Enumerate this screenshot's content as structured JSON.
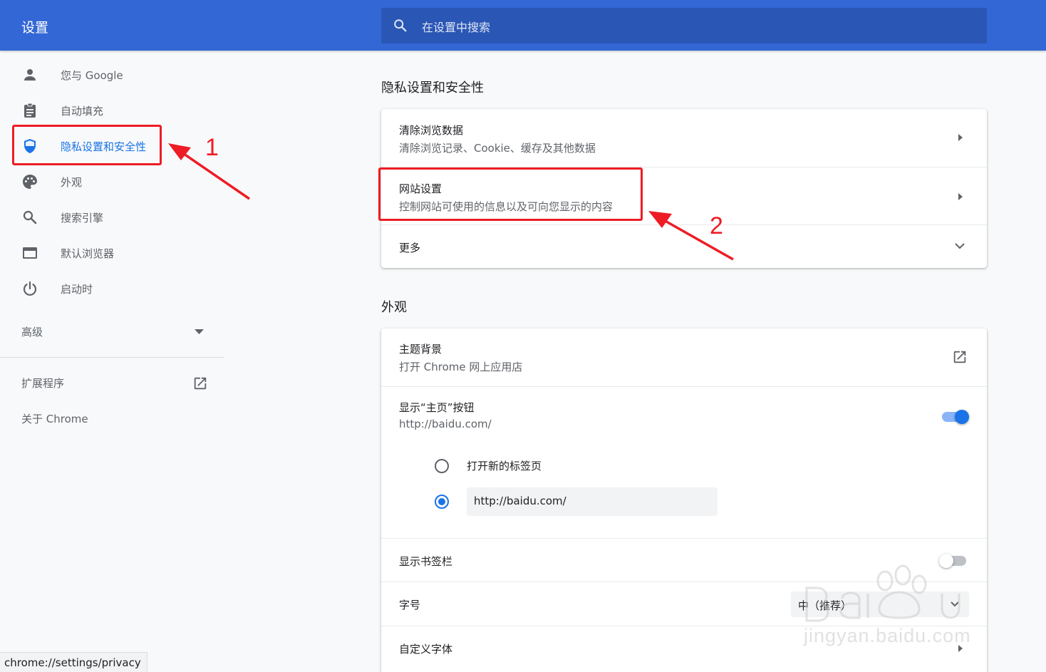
{
  "header": {
    "title": "设置",
    "search_placeholder": "在设置中搜索"
  },
  "sidebar": {
    "items": [
      {
        "label": "您与 Google",
        "icon": "person-icon"
      },
      {
        "label": "自动填充",
        "icon": "clipboard-icon"
      },
      {
        "label": "隐私设置和安全性",
        "icon": "shield-icon",
        "active": true
      },
      {
        "label": "外观",
        "icon": "palette-icon"
      },
      {
        "label": "搜索引擎",
        "icon": "search-icon"
      },
      {
        "label": "默认浏览器",
        "icon": "browser-icon"
      },
      {
        "label": "启动时",
        "icon": "power-icon"
      }
    ],
    "advanced": "高级",
    "extensions": "扩展程序",
    "about": "关于 Chrome"
  },
  "privacy": {
    "title": "隐私设置和安全性",
    "clear_title": "清除浏览数据",
    "clear_sub": "清除浏览记录、Cookie、缓存及其他数据",
    "site_title": "网站设置",
    "site_sub": "控制网站可使用的信息以及可向您显示的内容",
    "more": "更多"
  },
  "appearance": {
    "title": "外观",
    "theme_title": "主题背景",
    "theme_sub": "打开 Chrome 网上应用店",
    "home_title": "显示“主页”按钮",
    "home_sub": "http://baidu.com/",
    "home_enabled": true,
    "radio_newtab": "打开新的标签页",
    "radio_url": "http://baidu.com/",
    "bookmarks_title": "显示书签栏",
    "bookmarks_enabled": false,
    "fontsize_title": "字号",
    "fontsize_value": "中（推荐）",
    "customfont_title": "自定义字体"
  },
  "annotations": {
    "one": "1",
    "two": "2"
  },
  "status_url": "chrome://settings/privacy",
  "watermark": "jingyan.baidu.com",
  "colors": {
    "header": "#3367d6",
    "accent": "#1a73e8",
    "annotation": "#ee1c25"
  }
}
